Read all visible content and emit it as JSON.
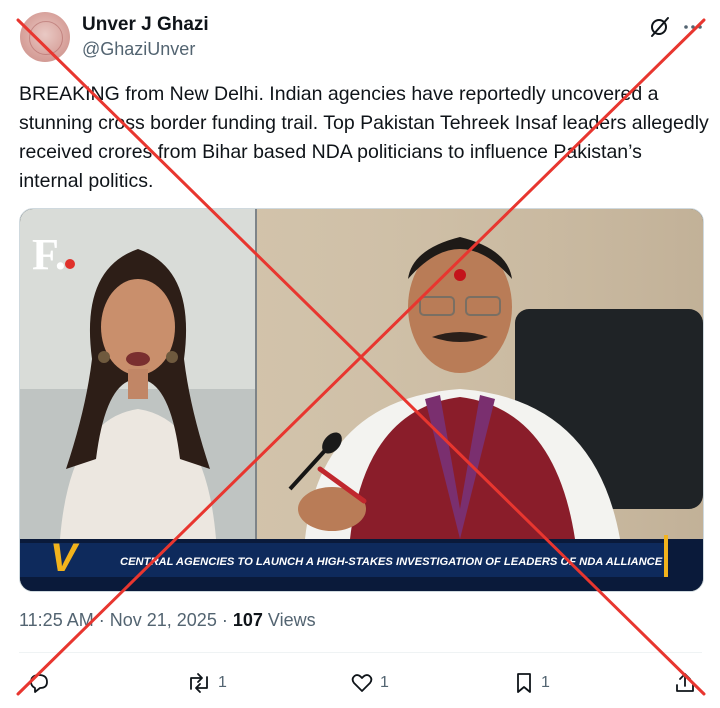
{
  "author": {
    "name": "Unver J Ghazi",
    "handle": "@GhaziUnver"
  },
  "tweet": {
    "text": "BREAKING from New Delhi. Indian agencies have reportedly uncovered a stunning cross border funding trail. Top Pakistan Tehreek Insaf leaders allegedly received crores from Bihar based NDA politicians to influence Pakistan’s internal politics."
  },
  "media": {
    "logo_text": "F.",
    "ticker_text": "CENTRAL AGENCIES TO LAUNCH A HIGH-STAKES INVESTIGATION OF LEADERS OF NDA ALLIANCE",
    "ticker_badge": "V"
  },
  "meta": {
    "time": "11:25 AM",
    "separator": "·",
    "date": "Nov 21, 2025",
    "views_count": "107",
    "views_label": "Views"
  },
  "actions": {
    "reply_count": "",
    "repost_count": "1",
    "like_count": "1",
    "bookmark_count": "1"
  },
  "icons": {
    "grok": "grok-icon",
    "more": "more-icon",
    "reply": "reply-icon",
    "repost": "repost-icon",
    "like": "heart-icon",
    "bookmark": "bookmark-icon",
    "share": "share-icon"
  },
  "colors": {
    "cross_out": "#e8362f",
    "text_primary": "#0f1419",
    "text_secondary": "#536471",
    "ticker_bg": "#0e2a5c",
    "ticker_accent": "#f2b31c"
  }
}
